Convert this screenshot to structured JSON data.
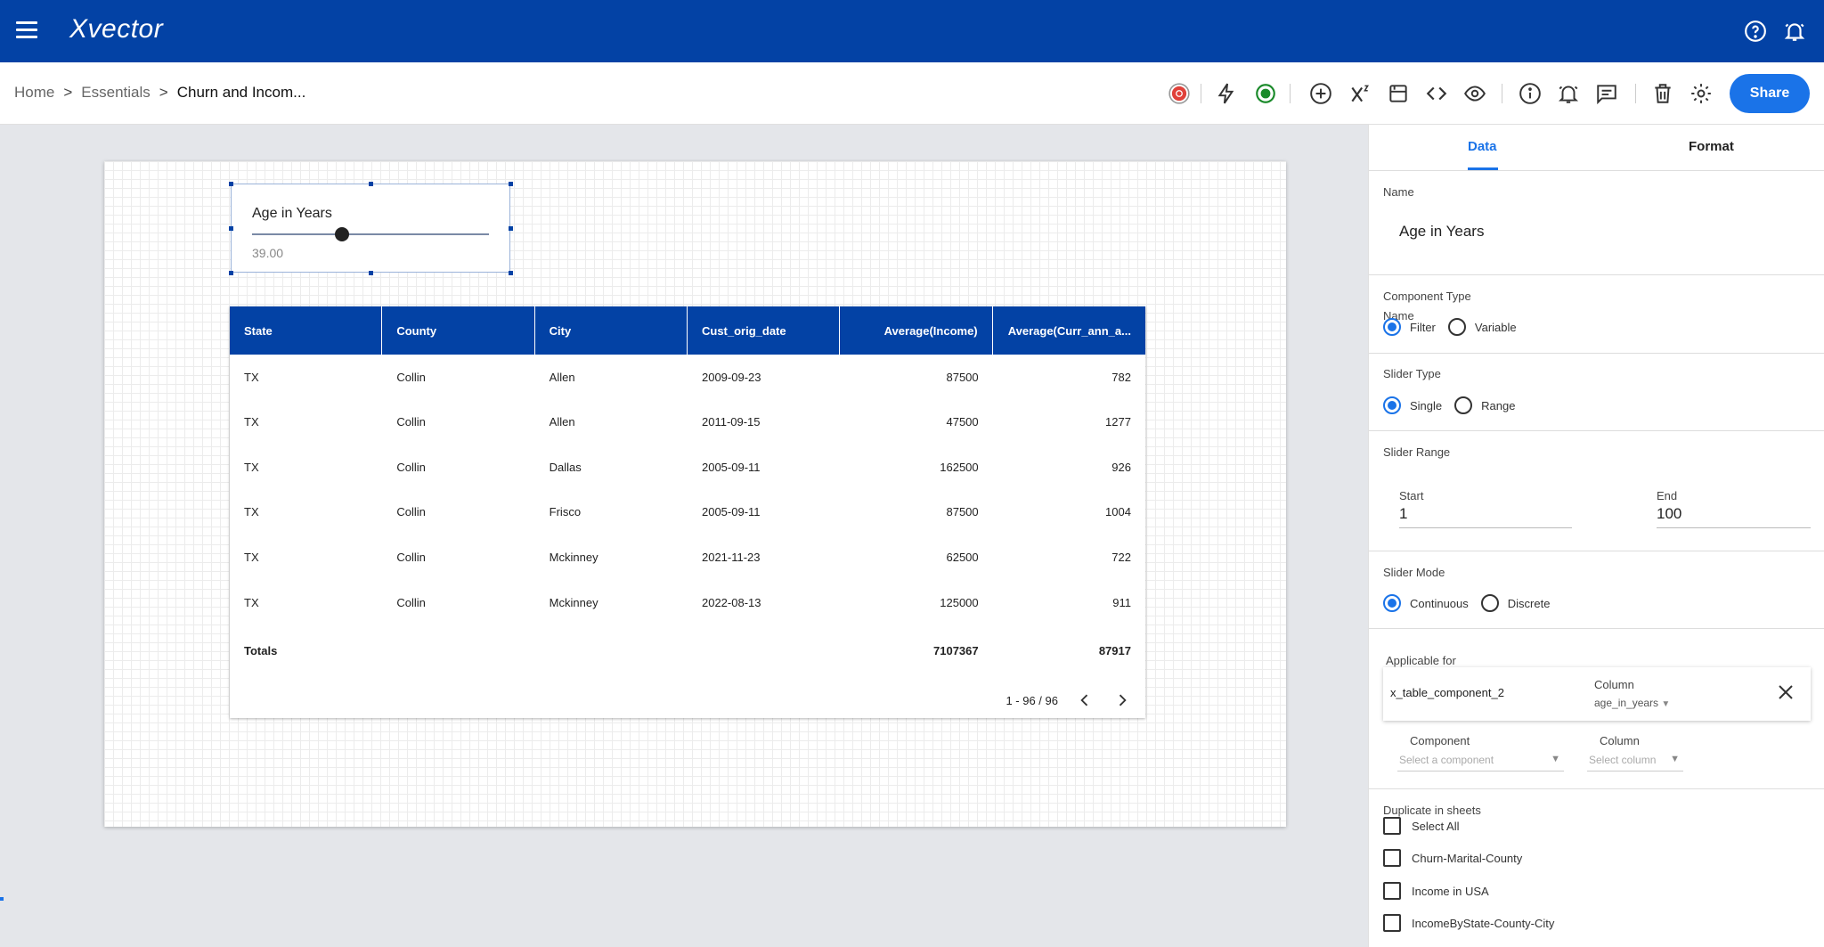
{
  "app": {
    "logo": "Xvector"
  },
  "breadcrumb": [
    "Home",
    "Essentials",
    "Churn and Incom..."
  ],
  "toolbar": {
    "share_label": "Share"
  },
  "slider": {
    "title": "Age in Years",
    "value": "39.00",
    "position_fraction": 0.38
  },
  "table": {
    "columns": [
      "State",
      "County",
      "City",
      "Cust_orig_date",
      "Average(Income)",
      "Average(Curr_ann_a..."
    ],
    "rows": [
      [
        "TX",
        "Collin",
        "Allen",
        "2009-09-23",
        "87500",
        "782"
      ],
      [
        "TX",
        "Collin",
        "Allen",
        "2011-09-15",
        "47500",
        "1277"
      ],
      [
        "TX",
        "Collin",
        "Dallas",
        "2005-09-11",
        "162500",
        "926"
      ],
      [
        "TX",
        "Collin",
        "Frisco",
        "2005-09-11",
        "87500",
        "1004"
      ],
      [
        "TX",
        "Collin",
        "Mckinney",
        "2021-11-23",
        "62500",
        "722"
      ],
      [
        "TX",
        "Collin",
        "Mckinney",
        "2022-08-13",
        "125000",
        "911"
      ]
    ],
    "totals": {
      "label": "Totals",
      "income": "7107367",
      "curr": "87917"
    },
    "pager": "1 - 96 / 96"
  },
  "panel": {
    "tabs": [
      "Data",
      "Format"
    ],
    "name_label": "Name",
    "name_value": "Age in Years",
    "component_type": {
      "label": "Component Type",
      "options": [
        "Filter",
        "Variable"
      ],
      "selected": "Filter"
    },
    "slider_type": {
      "label": "Slider Type",
      "options": [
        "Single",
        "Range"
      ],
      "selected": "Single"
    },
    "slider_range": {
      "label": "Slider Range",
      "start_label": "Start",
      "start": "1",
      "end_label": "End",
      "end": "100"
    },
    "slider_mode": {
      "label": "Slider Mode",
      "options": [
        "Continuous",
        "Discrete"
      ],
      "selected": "Continuous"
    },
    "applicable": {
      "label": "Applicable for",
      "component": "x_table_component_2",
      "column_label": "Column",
      "column": "age_in_years",
      "new_component_label": "Component",
      "new_component_placeholder": "Select a component",
      "new_column_label": "Column",
      "new_column_placeholder": "Select column"
    },
    "duplicate": {
      "label": "Duplicate in sheets",
      "items": [
        "Select All",
        "Churn-Marital-County",
        "Income in USA",
        "IncomeByState-County-City"
      ]
    }
  },
  "colors": {
    "brand": "#0342a5",
    "accent": "#1a73e8"
  }
}
